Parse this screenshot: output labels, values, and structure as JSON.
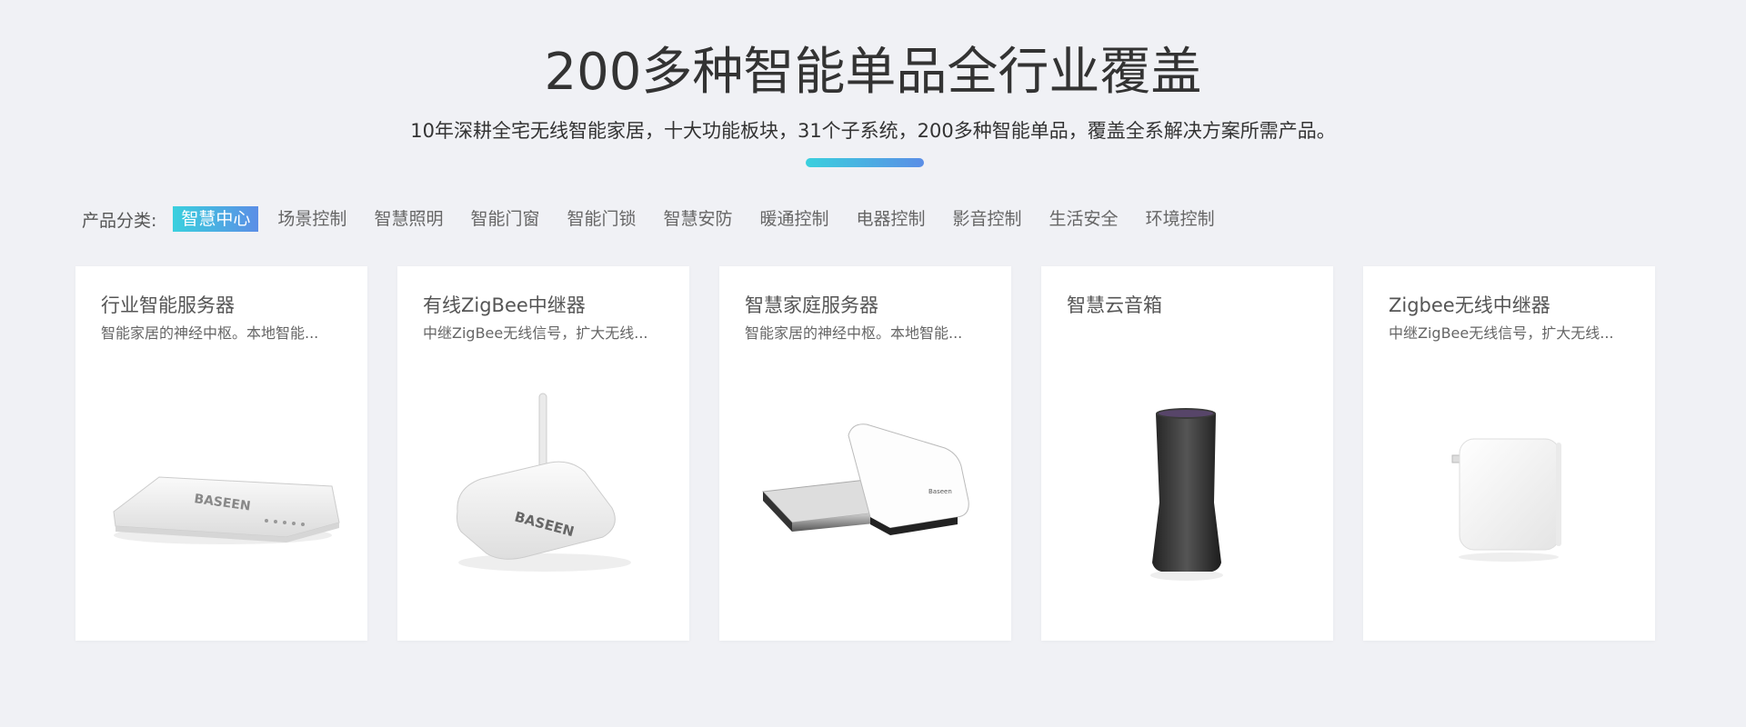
{
  "header": {
    "title": "200多种智能单品全行业覆盖",
    "subtitle": "10年深耕全宅无线智能家居，十大功能板块，31个子系统，200多种智能单品，覆盖全系解决方案所需产品。"
  },
  "categories": {
    "label": "产品分类:",
    "items": [
      {
        "label": "智慧中心",
        "active": true
      },
      {
        "label": "场景控制"
      },
      {
        "label": "智慧照明"
      },
      {
        "label": "智能门窗"
      },
      {
        "label": "智能门锁"
      },
      {
        "label": "智慧安防"
      },
      {
        "label": "暖通控制"
      },
      {
        "label": "电器控制"
      },
      {
        "label": "影音控制"
      },
      {
        "label": "生活安全"
      },
      {
        "label": "环境控制"
      }
    ]
  },
  "products": [
    {
      "title": "行业智能服务器",
      "desc": "智能家居的神经中枢。本地智能...",
      "image": "server-router-icon"
    },
    {
      "title": "有线ZigBee中继器",
      "desc": "中继ZigBee无线信号，扩大无线...",
      "image": "zigbee-repeater-icon"
    },
    {
      "title": "智慧家庭服务器",
      "desc": "智能家居的神经中枢。本地智能...",
      "image": "home-server-icon"
    },
    {
      "title": "智慧云音箱",
      "desc": "",
      "image": "smart-speaker-icon"
    },
    {
      "title": "Zigbee无线中继器",
      "desc": "中继ZigBee无线信号，扩大无线...",
      "image": "plug-repeater-icon"
    }
  ]
}
